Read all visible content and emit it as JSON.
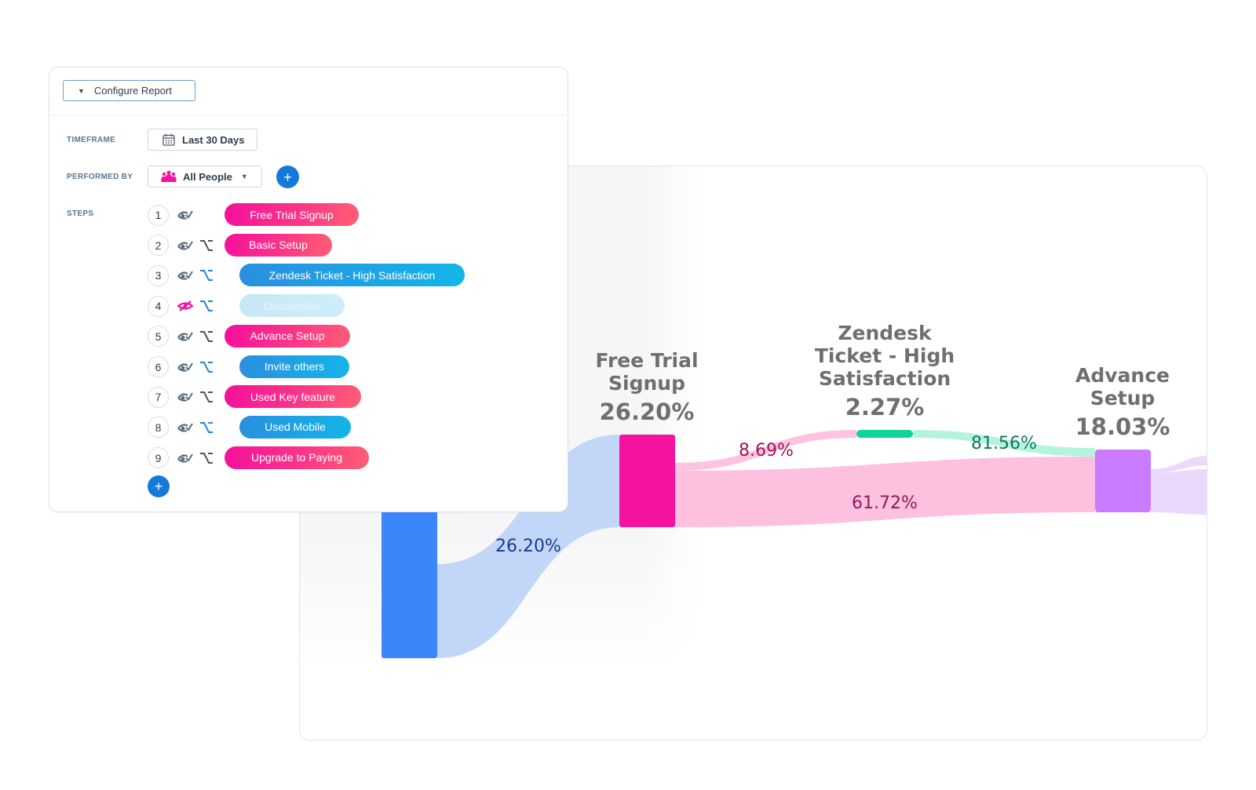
{
  "config": {
    "configure_label": "Configure Report",
    "timeframe_label": "TIMEFRAME",
    "timeframe_value": "Last 30 Days",
    "performed_by_label": "PERFORMED BY",
    "performed_by_value": "All People",
    "steps_label": "STEPS",
    "add_filter": "+",
    "add_step": "+",
    "steps": [
      {
        "num": "1",
        "label": "Free Trial Signup",
        "style": "pink",
        "indent": 0,
        "visible": true,
        "branch": false
      },
      {
        "num": "2",
        "label": "Basic Setup",
        "style": "pink",
        "indent": 0,
        "visible": true,
        "branch": true,
        "branch_color": "#4a5563"
      },
      {
        "num": "3",
        "label": "Zendesk Ticket - High Satisfaction",
        "style": "blue",
        "indent": 1,
        "visible": true,
        "branch": true,
        "branch_color": "#1f86d8"
      },
      {
        "num": "4",
        "label": "Dissatisfied",
        "style": "faded",
        "indent": 1,
        "visible": false,
        "branch": true,
        "branch_color": "#1f86d8"
      },
      {
        "num": "5",
        "label": "Advance Setup",
        "style": "pink",
        "indent": 0,
        "visible": true,
        "branch": true,
        "branch_color": "#4a5563"
      },
      {
        "num": "6",
        "label": "Invite others",
        "style": "blue",
        "indent": 1,
        "visible": true,
        "branch": true,
        "branch_color": "#1f86d8"
      },
      {
        "num": "7",
        "label": "Used Key feature",
        "style": "pink",
        "indent": 0,
        "visible": true,
        "branch": true,
        "branch_color": "#4a5563"
      },
      {
        "num": "8",
        "label": "Used Mobile",
        "style": "blue",
        "indent": 1,
        "visible": true,
        "branch": true,
        "branch_color": "#1f86d8"
      },
      {
        "num": "9",
        "label": "Upgrade to Paying",
        "style": "pink",
        "indent": 0,
        "visible": true,
        "branch": true,
        "branch_color": "#4a5563"
      }
    ]
  },
  "chart_data": {
    "type": "sankey",
    "nodes": [
      {
        "id": "start",
        "label": "",
        "pct": "",
        "color": "#3b86fb"
      },
      {
        "id": "free_trial",
        "label": "Free Trial Signup",
        "title_lines": [
          "Free Trial",
          "Signup"
        ],
        "pct": "26.20%",
        "color": "#f5129e"
      },
      {
        "id": "zendesk",
        "label": "Zendesk Ticket - High Satisfaction",
        "title_lines": [
          "Zendesk",
          "Ticket - High",
          "Satisfaction"
        ],
        "pct": "2.27%",
        "color": "#0fd39a"
      },
      {
        "id": "advance",
        "label": "Advance Setup",
        "title_lines": [
          "Advance",
          "Setup"
        ],
        "pct": "18.03%",
        "color": "#c97cff"
      }
    ],
    "links": [
      {
        "source": "start",
        "target": "free_trial",
        "value": 26.2,
        "label": "26.20%",
        "color": "#c2d6f8",
        "label_color": "#1b3a8f"
      },
      {
        "source": "free_trial",
        "target": "zendesk",
        "value": 8.69,
        "label": "8.69%",
        "color": "#fdc3e0",
        "label_color": "#a0135f"
      },
      {
        "source": "free_trial",
        "target": "advance",
        "value": 61.72,
        "label": "61.72%",
        "color": "#fdc0df",
        "label_color": "#8e1a5b"
      },
      {
        "source": "zendesk",
        "target": "advance",
        "value": 81.56,
        "label": "81.56%",
        "color": "#b4f4df",
        "label_color": "#0c7a5a"
      },
      {
        "source": "advance",
        "target": "next_a",
        "value": null,
        "label": "",
        "color": "#ecd8fd",
        "label_color": ""
      },
      {
        "source": "advance",
        "target": "next_b",
        "value": null,
        "label": "",
        "color": "#ecd8fd",
        "label_color": ""
      }
    ]
  }
}
